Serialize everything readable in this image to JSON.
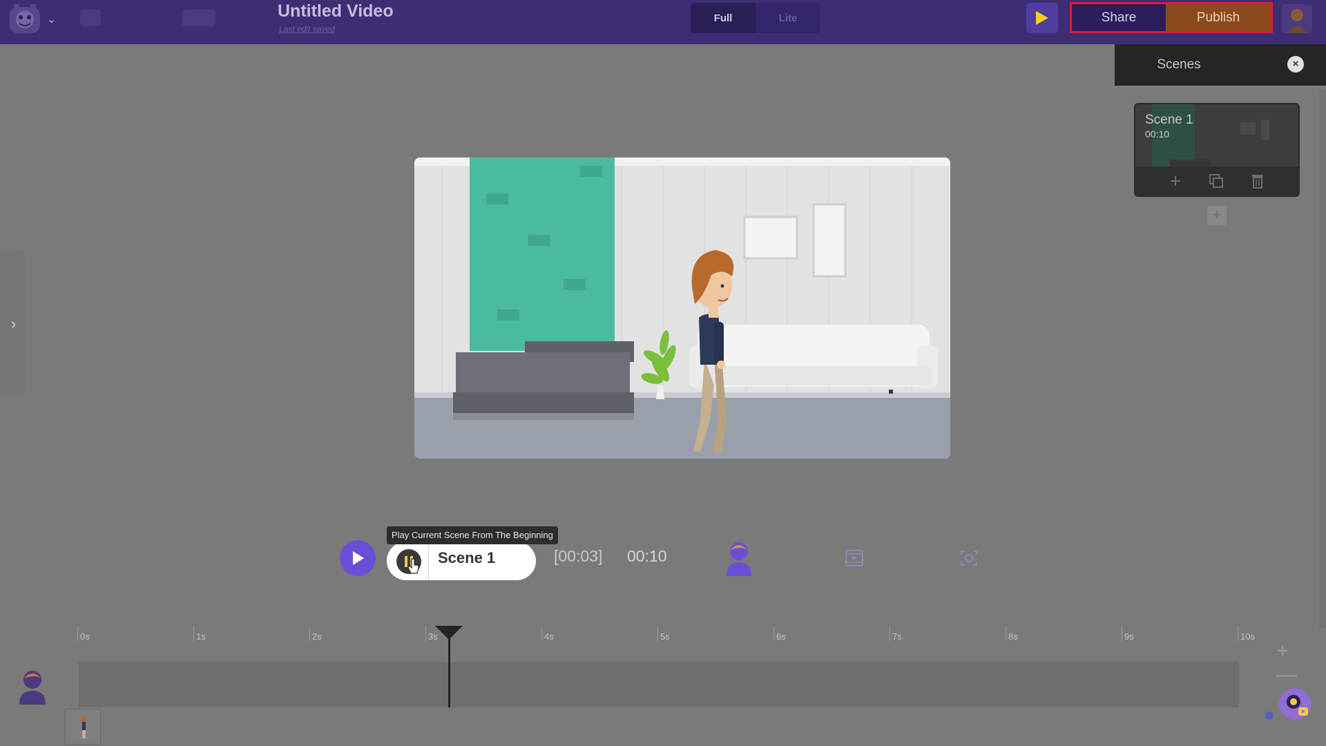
{
  "app": {
    "title": "Untitled Video",
    "last_edit": "Last edit saved"
  },
  "mode": {
    "full": "Full",
    "lite": "Lite",
    "selected": "Full"
  },
  "toolbar": {
    "share_label": "Share",
    "publish_label": "Publish"
  },
  "scenes_panel": {
    "title": "Scenes",
    "close_label": "×",
    "add_label": "+",
    "scenes": [
      {
        "name": "Scene 1",
        "duration": "00:10"
      }
    ]
  },
  "playback": {
    "tooltip": "Play Current Scene From The Beginning",
    "scene_name": "Scene 1",
    "current_time": "[00:03]",
    "total_time": "00:10"
  },
  "timeline": {
    "ticks": [
      "0s",
      "1s",
      "2s",
      "3s",
      "4s",
      "5s",
      "6s",
      "7s",
      "8s",
      "9s",
      "10s"
    ],
    "playhead_seconds": 3.2,
    "duration_seconds": 10,
    "zoom_in": "+",
    "zoom_out": "—"
  },
  "colors": {
    "topbar": "#3e2d73",
    "accent_purple": "#6a4fd6",
    "publish": "#8c4a1c",
    "highlight_border": "#e01a2f",
    "play_yellow": "#f7d21a"
  }
}
